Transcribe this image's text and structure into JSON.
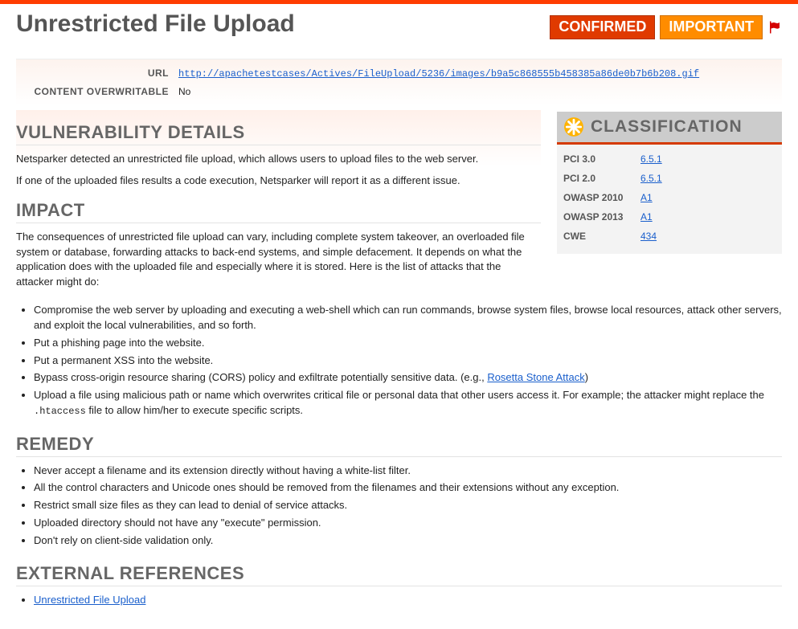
{
  "header": {
    "title": "Unrestricted File Upload",
    "confirmed_label": "CONFIRMED",
    "severity_label": "IMPORTANT"
  },
  "meta": {
    "url_label": "URL",
    "url_value": "http://apachetestcases/Actives/FileUpload/5236/images/b9a5c868555b458385a86de0b7b6b208.gif",
    "overwrite_label": "CONTENT OVERWRITABLE",
    "overwrite_value": "No"
  },
  "classification": {
    "heading": "CLASSIFICATION",
    "rows": [
      {
        "key": "PCI 3.0",
        "value": "6.5.1"
      },
      {
        "key": "PCI 2.0",
        "value": "6.5.1"
      },
      {
        "key": "OWASP 2010",
        "value": "A1"
      },
      {
        "key": "OWASP 2013",
        "value": "A1"
      },
      {
        "key": "CWE",
        "value": "434"
      }
    ]
  },
  "sections": {
    "vuln_heading": "VULNERABILITY DETAILS",
    "vuln_p1": "Netsparker detected an unrestricted file upload, which allows users to upload files to the web server.",
    "vuln_p2": "If one of the uploaded files results a code execution, Netsparker will report it as a different issue.",
    "impact_heading": "IMPACT",
    "impact_intro": "The consequences of unrestricted file upload can vary, including complete system takeover, an overloaded file system or database, forwarding attacks to back-end systems, and simple defacement. It depends on what the application does with the uploaded file and especially where it is stored. Here is the list of attacks that the attacker might do:",
    "impact_items": [
      "Compromise the web server by uploading and executing a web-shell which can run commands, browse system files, browse local resources, attack other servers, and exploit the local vulnerabilities, and so forth.",
      "Put a phishing page into the website.",
      "Put a permanent XSS into the website."
    ],
    "impact_item4_pre": "Bypass cross-origin resource sharing (CORS) policy and exfiltrate potentially sensitive data. (e.g., ",
    "impact_item4_link": "Rosetta Stone Attack",
    "impact_item4_post": ")",
    "impact_item5_pre": "Upload a file using malicious path or name which overwrites critical file or personal data that other users access it. For example; the attacker might replace the ",
    "impact_item5_code": ".htaccess",
    "impact_item5_post": " file to allow him/her to execute specific scripts.",
    "remedy_heading": "REMEDY",
    "remedy_items": [
      "Never accept a filename and its extension directly without having a white-list filter.",
      "All the control characters and Unicode ones should be removed from the filenames and their extensions without any exception.",
      "Restrict small size files as they can lead to denial of service attacks.",
      "Uploaded directory should not have any \"execute\" permission.",
      "Don't rely on client-side validation only."
    ],
    "refs_heading": "EXTERNAL REFERENCES",
    "refs_items": [
      "Unrestricted File Upload"
    ]
  }
}
